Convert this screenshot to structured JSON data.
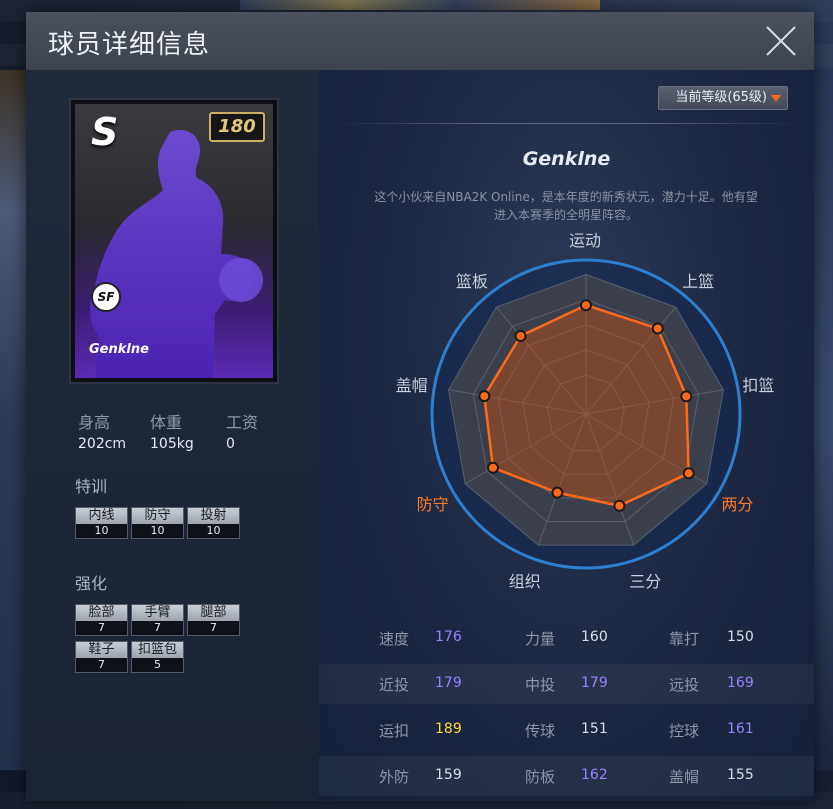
{
  "modal": {
    "title": "球员详细信息"
  },
  "card": {
    "grade": "S",
    "overall": "180",
    "position": "SF",
    "name": "Genklne"
  },
  "physical": {
    "labels": [
      "身高",
      "体重",
      "工资"
    ],
    "values": [
      "202cm",
      "105kg",
      "0"
    ]
  },
  "training": {
    "label": "特训",
    "items": [
      {
        "name": "内线",
        "value": "10"
      },
      {
        "name": "防守",
        "value": "10"
      },
      {
        "name": "投射",
        "value": "10"
      }
    ]
  },
  "enhance": {
    "label": "强化",
    "items": [
      {
        "name": "脸部",
        "value": "7"
      },
      {
        "name": "手臂",
        "value": "7"
      },
      {
        "name": "腿部",
        "value": "7"
      },
      {
        "name": "鞋子",
        "value": "7"
      },
      {
        "name": "扣篮包",
        "value": "5"
      }
    ]
  },
  "level_dropdown": "当前等级(65级)",
  "player": {
    "name": "Genklne",
    "description": "这个小伙来自NBA2K Online，是本年度的新秀状元，潜力十足。他有望进入本赛季的全明星阵容。"
  },
  "radar": {
    "axes": [
      "运动",
      "上篮",
      "扣篮",
      "两分",
      "三分",
      "组织",
      "防守",
      "盖帽",
      "篮板"
    ],
    "highlight": [
      "两分",
      "防守"
    ],
    "values": [
      0.78,
      0.8,
      0.73,
      0.85,
      0.7,
      0.6,
      0.77,
      0.74,
      0.73
    ]
  },
  "stats": [
    [
      {
        "name": "速度",
        "value": "176",
        "tone": "purple"
      },
      {
        "name": "力量",
        "value": "160",
        "tone": "white"
      },
      {
        "name": "靠打",
        "value": "150",
        "tone": "white"
      }
    ],
    [
      {
        "name": "近投",
        "value": "179",
        "tone": "purple"
      },
      {
        "name": "中投",
        "value": "179",
        "tone": "purple"
      },
      {
        "name": "远投",
        "value": "169",
        "tone": "purple"
      }
    ],
    [
      {
        "name": "运扣",
        "value": "189",
        "tone": "gold"
      },
      {
        "name": "传球",
        "value": "151",
        "tone": "white"
      },
      {
        "name": "控球",
        "value": "161",
        "tone": "purple"
      }
    ],
    [
      {
        "name": "外防",
        "value": "159",
        "tone": "white"
      },
      {
        "name": "防板",
        "value": "162",
        "tone": "purple"
      },
      {
        "name": "盖帽",
        "value": "155",
        "tone": "white"
      }
    ]
  ],
  "colors": {
    "accent": "#ff6a1a",
    "purple_value": "#9a82ff",
    "gold_value": "#ffd83a"
  }
}
